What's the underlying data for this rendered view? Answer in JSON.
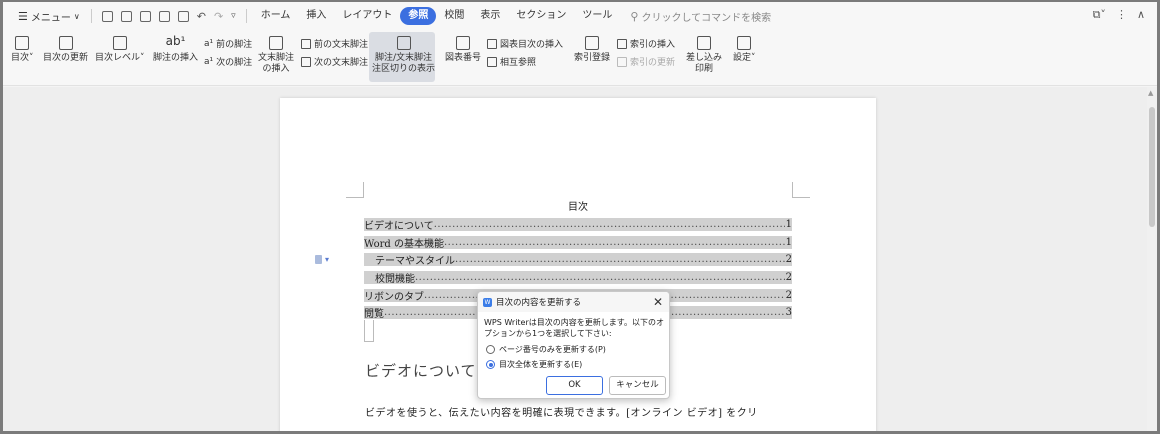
{
  "menubar": {
    "menu_label": "メニュー",
    "tabs": [
      "ホーム",
      "挿入",
      "レイアウト",
      "参照",
      "校閲",
      "表示",
      "セクション",
      "ツール"
    ],
    "active_tab": "参照",
    "search_placeholder": "クリックしてコマンドを検索"
  },
  "ribbon": {
    "toc": "目次",
    "update_toc": "目次の更新",
    "toc_level": "目次レベル",
    "insert_footnote": "脚注の挿入",
    "prev_footnote": "前の脚注",
    "next_footnote": "次の脚注",
    "insert_endnote_1": "文末脚注",
    "insert_endnote_2": "の挿入",
    "prev_endnote": "前の文末脚注",
    "next_endnote": "次の文末脚注",
    "separator_1": "脚注/文末脚注",
    "separator_2": "注区切りの表示",
    "caption": "図表番号",
    "insert_table_of_figures": "図表目次の挿入",
    "cross_reference": "相互参照",
    "mark_entry": "索引登録",
    "insert_index": "索引の挿入",
    "update_index": "索引の更新",
    "mail_merge_1": "差し込み",
    "mail_merge_2": "印刷",
    "settings": "設定"
  },
  "document": {
    "toc_title": "目次",
    "toc_entries": [
      {
        "text": "ビデオについて",
        "page": "1"
      },
      {
        "text": "Word の基本機能",
        "page": "1"
      },
      {
        "text": "テーマやスタイル",
        "page": "2"
      },
      {
        "text": "校閲機能",
        "page": "2"
      },
      {
        "text": "リボンのタブ",
        "page": "2"
      },
      {
        "text": "閲覧",
        "page": "3"
      }
    ],
    "heading": "ビデオについて",
    "body": "ビデオを使うと、伝えたい内容を明確に表現できます。[オンライン ビデオ] をクリ"
  },
  "dialog": {
    "title": "目次の内容を更新する",
    "message": "WPS Writerは目次の内容を更新します。以下のオプションから1つを選択して下さい:",
    "option_page_only": "ページ番号のみを更新する(P)",
    "option_entire": "目次全体を更新する(E)",
    "ok": "OK",
    "cancel": "キャンセル"
  },
  "colors": {
    "accent": "#3b6fe0",
    "toc_highlight": "#d0d0d0"
  }
}
